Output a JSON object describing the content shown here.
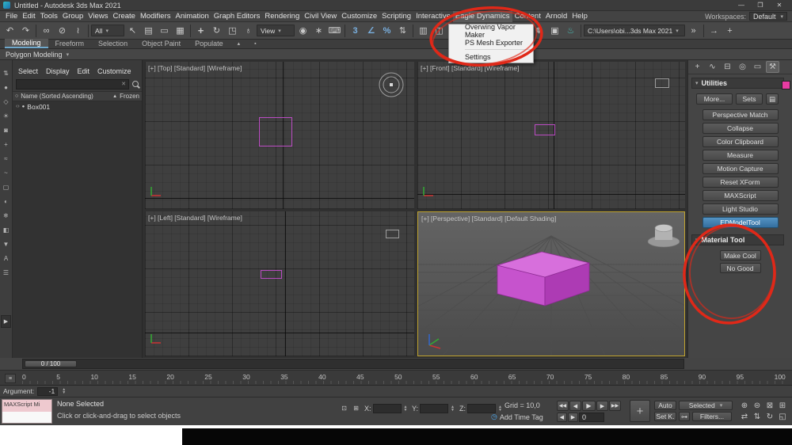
{
  "window": {
    "title": "Untitled - Autodesk 3ds Max 2021"
  },
  "menu_bar": {
    "items": [
      "File",
      "Edit",
      "Tools",
      "Group",
      "Views",
      "Create",
      "Modifiers",
      "Animation",
      "Graph Editors",
      "Rendering",
      "Civil View",
      "Customize",
      "Scripting",
      "Interactive",
      "Eagle Dynamics",
      "Content",
      "Arnold",
      "Help"
    ],
    "workspaces_label": "Workspaces:",
    "workspace_value": "Default"
  },
  "eagle_menu": {
    "items": [
      "Overwing Vapor Maker",
      "PS Mesh Exporter",
      "Settings"
    ]
  },
  "toolbar": {
    "selection_filter": "All",
    "coordinate_system": "View",
    "project_path": "C:\\Users\\obi...3ds Max 2021"
  },
  "ribbon": {
    "tabs": [
      "Modeling",
      "Freeform",
      "Selection",
      "Object Paint",
      "Populate"
    ],
    "section_label": "Polygon Modeling"
  },
  "scene_explorer": {
    "menu": [
      "Select",
      "Display",
      "Edit",
      "Customize"
    ],
    "columns": {
      "name": "Name (Sorted Ascending)",
      "frozen": "Frozen"
    },
    "items": [
      {
        "name": "Box001"
      }
    ]
  },
  "viewports": {
    "top_label": "[+] [Top] [Standard] [Wireframe]",
    "front_label": "[+] [Front] [Standard] [Wireframe]",
    "left_label": "[+] [Left] [Standard] [Wireframe]",
    "perspective_label": "[+] [Perspective] [Standard] [Default Shading]"
  },
  "command_panel": {
    "utilities_title": "Utilities",
    "more_button": "More...",
    "sets_button": "Sets",
    "utility_buttons": [
      "Perspective Match",
      "Collapse",
      "Color Clipboard",
      "Measure",
      "Motion Capture",
      "Reset XForm",
      "MAXScript",
      "Light Studio",
      "EDModelTool"
    ],
    "material_tool_title": "Material Tool",
    "material_buttons": [
      "Make Cool",
      "No Good"
    ]
  },
  "timeline": {
    "slider_label": "0 / 100",
    "ticks": [
      "0",
      "5",
      "10",
      "15",
      "20",
      "25",
      "30",
      "35",
      "40",
      "45",
      "50",
      "55",
      "60",
      "65",
      "70",
      "75",
      "80",
      "85",
      "90",
      "95",
      "100"
    ]
  },
  "status_bar": {
    "argument_label": "Argument:",
    "argument_value": "-1",
    "listener_text": "MAXScript Mi",
    "prompt_line1": "None Selected",
    "prompt_line2": "Click or click-and-drag to select objects",
    "x_label": "X:",
    "y_label": "Y:",
    "z_label": "Z:",
    "grid_label": "Grid = 10,0",
    "add_time_tag": "Add Time Tag",
    "auto_key": "Auto",
    "selected_mode": "Selected",
    "set_key": "Set K.",
    "filters": "Filters...",
    "frame_value": "0"
  },
  "colors": {
    "selection_magenta": "#c94fd1",
    "active_tool_blue": "#3f7fae",
    "annotation_red": "#e02818"
  }
}
